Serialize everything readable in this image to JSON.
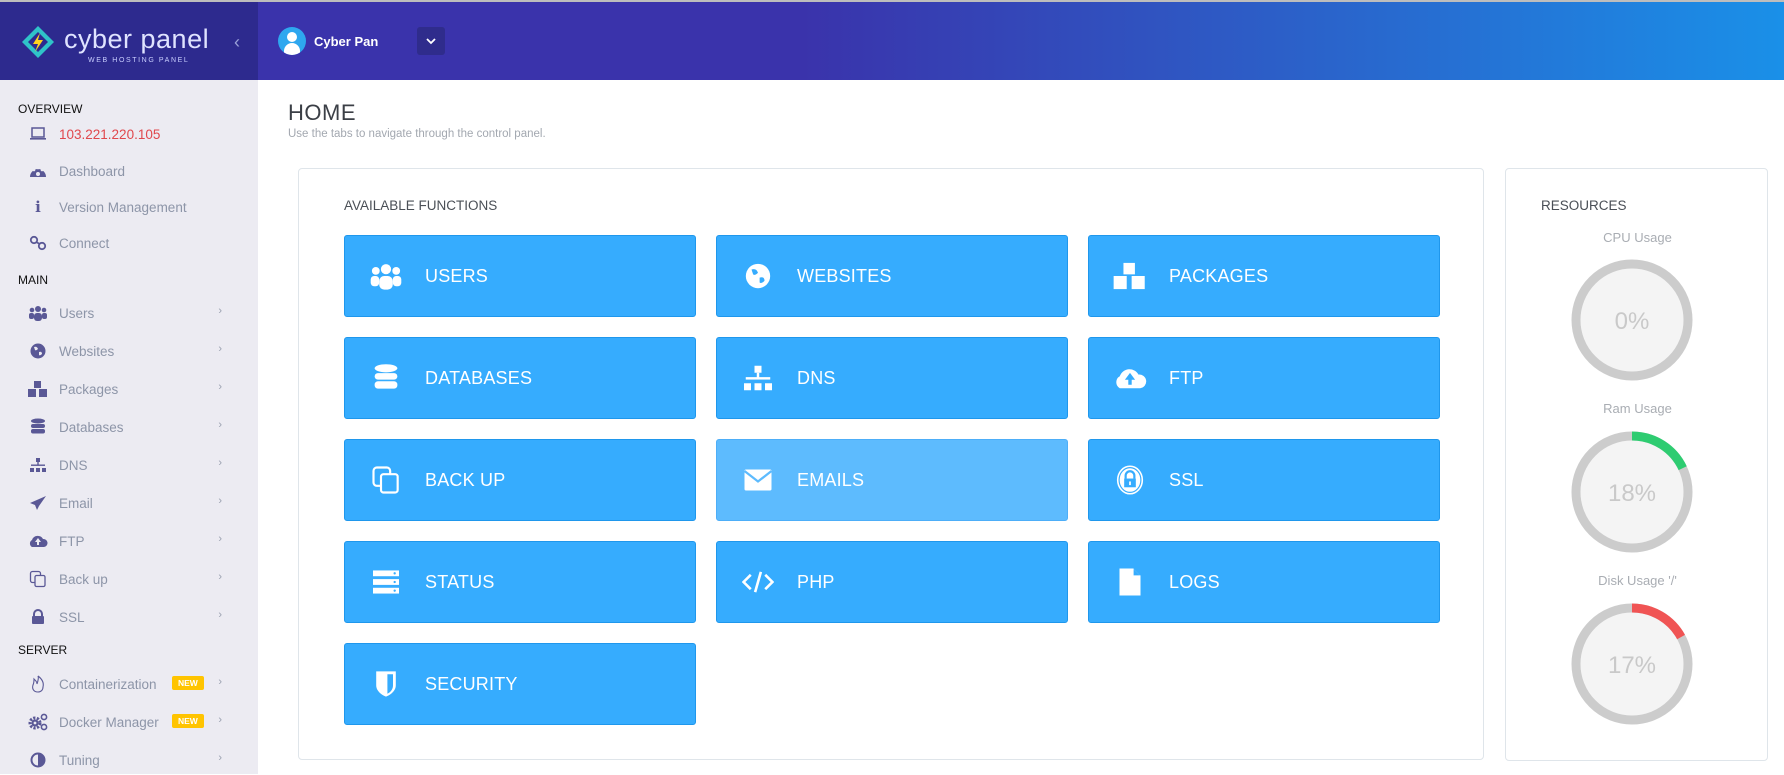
{
  "header": {
    "logo_text": "cyber panel",
    "logo_subtext": "WEB HOSTING PANEL",
    "collapse_icon": "chevron-left-icon",
    "user_name": "Cyber Pan",
    "user_dropdown_icon": "chevron-down-icon"
  },
  "sidebar": {
    "sections": [
      {
        "title": "OVERVIEW",
        "items": [
          {
            "label": "103.221.220.105",
            "icon": "laptop-icon",
            "highlight": true
          },
          {
            "label": "Dashboard",
            "icon": "dashboard-icon"
          },
          {
            "label": "Version Management",
            "icon": "info-icon"
          },
          {
            "label": "Connect",
            "icon": "link-icon"
          }
        ]
      },
      {
        "title": "MAIN",
        "items": [
          {
            "label": "Users",
            "icon": "users-icon"
          },
          {
            "label": "Websites",
            "icon": "globe-icon"
          },
          {
            "label": "Packages",
            "icon": "cubes-icon"
          },
          {
            "label": "Databases",
            "icon": "database-icon"
          },
          {
            "label": "DNS",
            "icon": "sitemap-icon"
          },
          {
            "label": "Email",
            "icon": "paper-plane-icon"
          },
          {
            "label": "FTP",
            "icon": "cloud-upload-icon"
          },
          {
            "label": "Back up",
            "icon": "copy-icon"
          },
          {
            "label": "SSL",
            "icon": "lock-icon"
          }
        ]
      },
      {
        "title": "SERVER",
        "items": [
          {
            "label": "Containerization",
            "icon": "fire-icon",
            "badge": "NEW"
          },
          {
            "label": "Docker Manager",
            "icon": "cogs-icon",
            "badge": "NEW"
          },
          {
            "label": "Tuning",
            "icon": "adjust-icon"
          }
        ]
      }
    ]
  },
  "page": {
    "title": "HOME",
    "subtitle": "Use the tabs to navigate through the control panel."
  },
  "functions": {
    "title": "AVAILABLE FUNCTIONS",
    "tiles": [
      {
        "label": "USERS",
        "icon": "users-icon"
      },
      {
        "label": "WEBSITES",
        "icon": "globe-icon"
      },
      {
        "label": "PACKAGES",
        "icon": "cubes-icon"
      },
      {
        "label": "DATABASES",
        "icon": "database-icon"
      },
      {
        "label": "DNS",
        "icon": "sitemap-icon"
      },
      {
        "label": "FTP",
        "icon": "cloud-upload-icon"
      },
      {
        "label": "BACK UP",
        "icon": "copy-icon"
      },
      {
        "label": "EMAILS",
        "icon": "envelope-icon",
        "hovered": true
      },
      {
        "label": "SSL",
        "icon": "lock-icon"
      },
      {
        "label": "STATUS",
        "icon": "server-icon"
      },
      {
        "label": "PHP",
        "icon": "code-icon"
      },
      {
        "label": "LOGS",
        "icon": "file-icon"
      },
      {
        "label": "SECURITY",
        "icon": "shield-icon"
      }
    ]
  },
  "resources": {
    "title": "RESOURCES",
    "gauges": [
      {
        "label": "CPU Usage",
        "value": 0,
        "display": "0%",
        "color": "#2ecc71"
      },
      {
        "label": "Ram Usage",
        "value": 18,
        "display": "18%",
        "color": "#2ecc71"
      },
      {
        "label": "Disk Usage '/'",
        "value": 17,
        "display": "17%",
        "color": "#f05454"
      }
    ]
  },
  "colors": {
    "tile": "#36acfe",
    "tile_hover": "#5dbbfe",
    "badge": "#ffc400",
    "ip_highlight": "#e0474c",
    "gauge_track": "#cccccc"
  }
}
